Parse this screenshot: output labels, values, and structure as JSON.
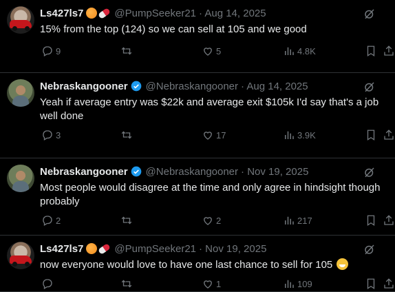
{
  "tweets": [
    {
      "name": "Ls427ls7",
      "handle": "@PumpSeeker21",
      "date": "· Aug 14, 2025",
      "text": "15% from the top (124)  so we can sell at 105 and we good",
      "replies": "9",
      "retweets": "",
      "likes": "5",
      "views": "4.8K",
      "verified": false,
      "emojis": [
        "orange-emoji",
        "pill-emoji"
      ]
    },
    {
      "name": "Nebraskangooner",
      "handle": "@Nebraskangooner",
      "date": "· Aug 14, 2025",
      "text": "Yeah if average entry was $22k and average exit $105k I'd say that's a job well done",
      "replies": "3",
      "retweets": "",
      "likes": "17",
      "views": "3.9K",
      "verified": true
    },
    {
      "name": "Nebraskangooner",
      "handle": "@Nebraskangooner",
      "date": "· Nov 19, 2025",
      "text": "Most people would disagree at the time and only agree in hindsight though probably",
      "replies": "2",
      "retweets": "",
      "likes": "2",
      "views": "217",
      "verified": true
    },
    {
      "name": "Ls427ls7",
      "handle": "@PumpSeeker21",
      "date": "· Nov 19, 2025",
      "text": "now everyone would love to have one last chance to sell for 105",
      "replies": "",
      "retweets": "",
      "likes": "1",
      "views": "109",
      "verified": false,
      "emojis": [
        "orange-emoji",
        "pill-emoji"
      ],
      "trailing_emoji": "grinning-sweat-emoji"
    }
  ],
  "colors": {
    "background": "#000000",
    "text": "#e7e9ea",
    "muted": "#71767b",
    "verified": "#1d9bf0",
    "divider": "#2f3336"
  }
}
